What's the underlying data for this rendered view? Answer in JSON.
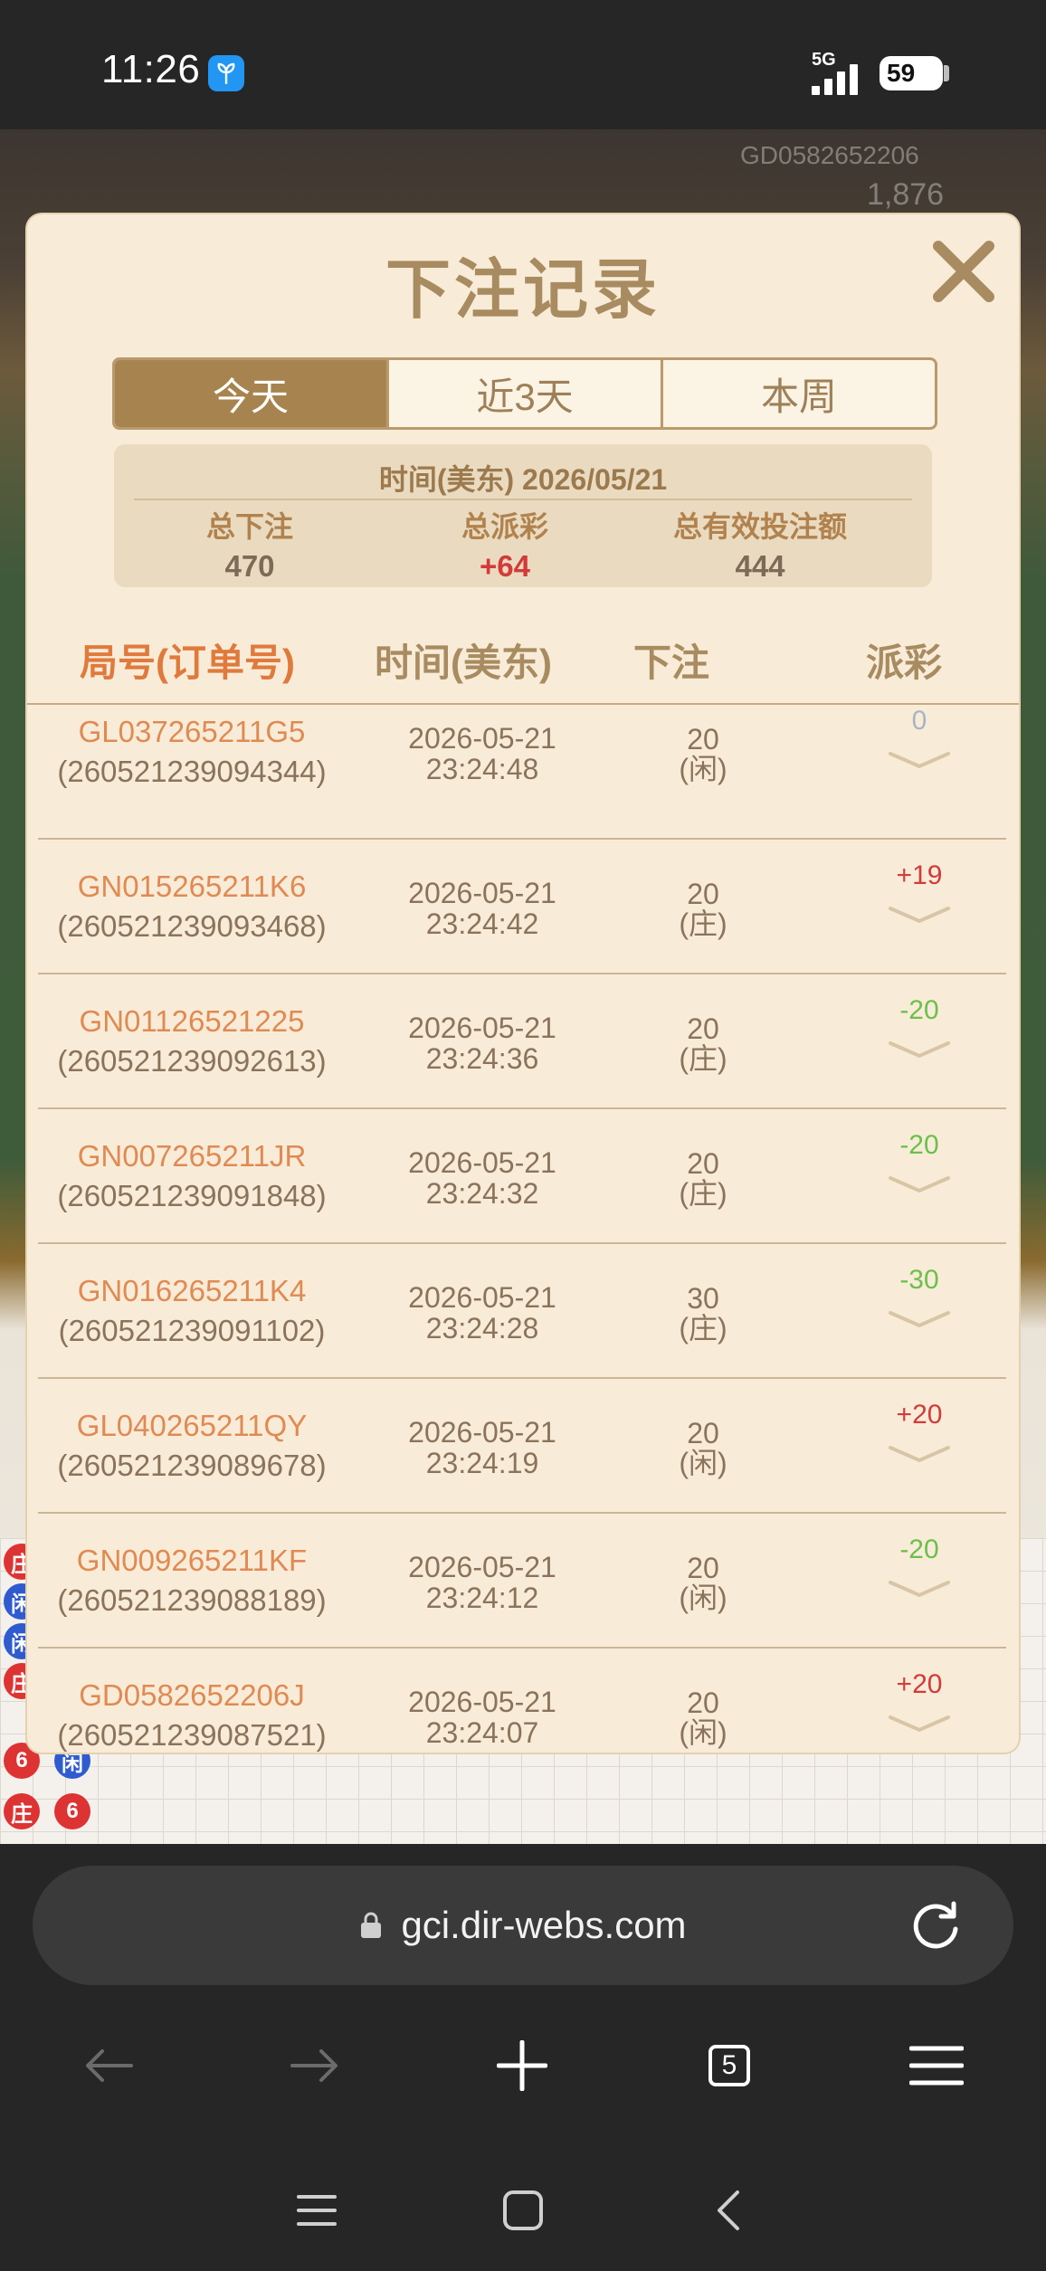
{
  "status_bar": {
    "time": "11:26",
    "network": "5G",
    "battery": "59"
  },
  "background": {
    "game_id": "GD0582652206",
    "game_number": "1,876"
  },
  "modal": {
    "title": "下注记录",
    "tabs": [
      {
        "label": "今天",
        "active": true
      },
      {
        "label": "近3天",
        "active": false
      },
      {
        "label": "本周",
        "active": false
      }
    ],
    "summary": {
      "time": "时间(美东) 2026/05/21",
      "total_bet_label": "总下注",
      "total_bet": "470",
      "total_payout_label": "总派彩",
      "total_payout": "+64",
      "valid_bet_label": "总有效投注额",
      "valid_bet": "444"
    },
    "columns": [
      "局号(订单号)",
      "时间(美东)",
      "下注",
      "派彩"
    ],
    "rows": [
      {
        "game_id": "GL037265211G5",
        "order_no": "(260521239094344)",
        "date": "2026-05-21",
        "time": "23:24:48",
        "bet": "20",
        "side": "(闲)",
        "payout": "0"
      },
      {
        "game_id": "GN015265211K6",
        "order_no": "(260521239093468)",
        "date": "2026-05-21",
        "time": "23:24:42",
        "bet": "20",
        "side": "(庄)",
        "payout": "+19"
      },
      {
        "game_id": "GN01126521225",
        "order_no": "(260521239092613)",
        "date": "2026-05-21",
        "time": "23:24:36",
        "bet": "20",
        "side": "(庄)",
        "payout": "-20"
      },
      {
        "game_id": "GN007265211JR",
        "order_no": "(260521239091848)",
        "date": "2026-05-21",
        "time": "23:24:32",
        "bet": "20",
        "side": "(庄)",
        "payout": "-20"
      },
      {
        "game_id": "GN016265211K4",
        "order_no": "(260521239091102)",
        "date": "2026-05-21",
        "time": "23:24:28",
        "bet": "30",
        "side": "(庄)",
        "payout": "-30"
      },
      {
        "game_id": "GL040265211QY",
        "order_no": "(260521239089678)",
        "date": "2026-05-21",
        "time": "23:24:19",
        "bet": "20",
        "side": "(闲)",
        "payout": "+20"
      },
      {
        "game_id": "GN009265211KF",
        "order_no": "(260521239088189)",
        "date": "2026-05-21",
        "time": "23:24:12",
        "bet": "20",
        "side": "(闲)",
        "payout": "-20"
      },
      {
        "game_id": "GD0582652206J",
        "order_no": "(260521239087521)",
        "date": "2026-05-21",
        "time": "23:24:07",
        "bet": "20",
        "side": "(闲)",
        "payout": "+20"
      }
    ]
  },
  "browser": {
    "url": "gci.dir-webs.com",
    "tab_count": "5"
  },
  "colors": {
    "accent": "#a7844f",
    "positive": "#d43a3a",
    "negative": "#6cc04a",
    "order_id": "#e08a53"
  },
  "icons": [
    "app-badge-icon",
    "signal-icon",
    "battery-icon",
    "close-icon",
    "chevron-down-icon",
    "lock-icon",
    "reload-icon",
    "back-arrow-icon",
    "forward-arrow-icon",
    "plus-icon",
    "tabs-icon",
    "menu-icon",
    "recents-icon",
    "home-icon",
    "system-back-icon"
  ]
}
